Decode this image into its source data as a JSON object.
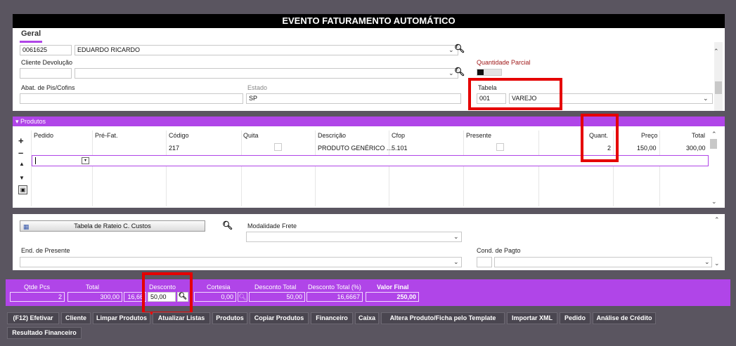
{
  "title": "EVENTO FATURAMENTO AUTOMÁTICO",
  "header": {
    "tab_label": "Geral",
    "client_code": "0061625",
    "client_name": "EDUARDO RICARDO",
    "cliente_devolucao_label": "Cliente Devolução",
    "quantidade_parcial_label": "Quantidade Parcial",
    "abat_label": "Abat. de Pis/Cofins",
    "estado_label": "Estado",
    "estado_value": "SP",
    "tabela_label": "Tabela",
    "tabela_code": "001",
    "tabela_name": "VAREJO"
  },
  "products": {
    "bar_label": "▾ Produtos",
    "columns": [
      "Pedido",
      "Pré-Fat.",
      "Código",
      "Quita",
      "Descrição",
      "Cfop",
      "Presente",
      "Quant.",
      "Preço",
      "Total"
    ],
    "rows": [
      {
        "codigo": "217",
        "descricao": "PRODUTO GENÉRICO ...",
        "cfop": "5.101",
        "quant": "2",
        "preco": "150,00",
        "total": "300,00"
      }
    ]
  },
  "lower": {
    "rateio_button": "Tabela de Rateio C. Custos",
    "modalidade_frete_label": "Modalidade Frete",
    "end_presente_label": "End. de Presente",
    "cond_pagto_label": "Cond. de Pagto"
  },
  "totals": {
    "qtde_pcs_label": "Qtde Pcs",
    "qtde_pcs": "2",
    "total_label": "Total",
    "total": "300,00",
    "percent_value": "16,66",
    "desconto_label": "Desconto",
    "desconto": "50,00",
    "cortesia_label": "Cortesia",
    "cortesia": "0,00",
    "desconto_total_label": "Desconto Total",
    "desconto_total": "50,00",
    "desconto_total_pct_label": "Desconto Total (%)",
    "desconto_total_pct": "16,6667",
    "valor_final_label": "Valor Final",
    "valor_final": "250,00"
  },
  "actions": [
    "(F12) Efetivar",
    "Cliente",
    "Limpar Produtos",
    "Atualizar Listas",
    "Produtos",
    "Copiar Produtos",
    "Financeiro",
    "Caixa",
    "Altera Produto/Ficha pelo Template",
    "Importar XML",
    "Pedido",
    "Análise de Crédito",
    "Resultado Financeiro"
  ],
  "colors": {
    "accent": "#b045e8",
    "highlight": "#e50000",
    "background": "#5a5560"
  }
}
